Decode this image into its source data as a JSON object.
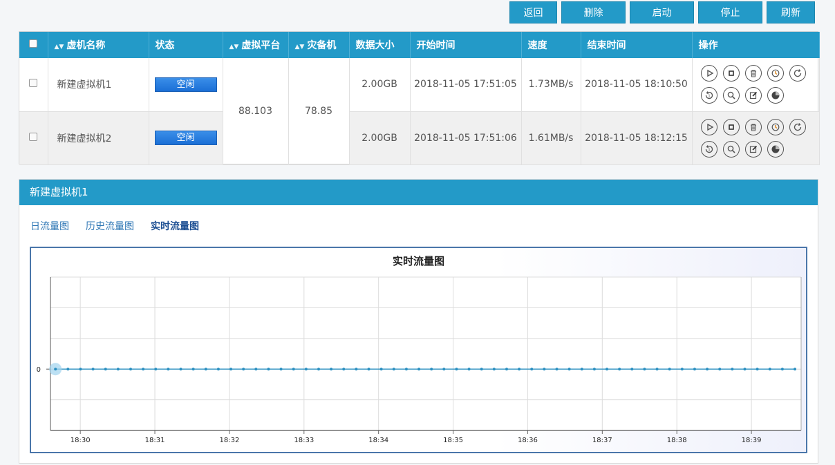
{
  "toolbar": {
    "back": "返回",
    "delete": "删除",
    "start": "启动",
    "stop": "停止",
    "refresh": "刷新"
  },
  "table": {
    "headers": {
      "name": "虚机名称",
      "status": "状态",
      "platform": "虚拟平台",
      "standby": "灾备机",
      "size": "数据大小",
      "start_time": "开始时间",
      "speed": "速度",
      "end_time": "结束时间",
      "ops": "操作"
    },
    "shared": {
      "platform": "88.103",
      "standby": "78.85"
    },
    "rows": [
      {
        "name": "新建虚拟机1",
        "status": "空闲",
        "size": "2.00GB",
        "start_time": "2018-11-05 17:51:05",
        "speed": "1.73MB/s",
        "end_time": "2018-11-05 18:10:50"
      },
      {
        "name": "新建虚拟机2",
        "status": "空闲",
        "size": "2.00GB",
        "start_time": "2018-11-05 17:51:06",
        "speed": "1.61MB/s",
        "end_time": "2018-11-05 18:12:15"
      }
    ]
  },
  "panel": {
    "title": "新建虚拟机1",
    "tabs": [
      "日流量图",
      "历史流量图",
      "实时流量图"
    ],
    "active_tab": "实时流量图"
  },
  "chart_data": {
    "type": "line",
    "title": "实时流量图",
    "xlabel": "",
    "ylabel": "",
    "x_ticks": [
      "18:30",
      "18:31",
      "18:32",
      "18:33",
      "18:34",
      "18:35",
      "18:36",
      "18:37",
      "18:38",
      "18:39"
    ],
    "y_ticks": [
      "0"
    ],
    "grid": true,
    "series": [
      {
        "color": "#2a8fc0",
        "x_start": "18:29:40",
        "x_end": "18:39:35",
        "point_count": 60,
        "values_constant": 0
      }
    ]
  }
}
